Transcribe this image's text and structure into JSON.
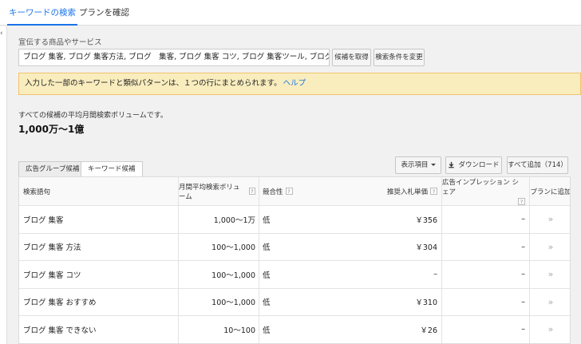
{
  "topnav": {
    "tabs": [
      "キーワードの検索",
      "プランを確認"
    ]
  },
  "leftbar": {
    "collapse_icon": "‹"
  },
  "search": {
    "label": "宣伝する商品やサービス",
    "value": "ブログ 集客, ブログ 集客方法, ブログ　集客, ブログ 集客 コツ, ブログ 集客ツール, ブログ 集客 おすすめ",
    "get_button": "候補を取得",
    "change_button": "検索条件を変更"
  },
  "notice": {
    "text": "入力した一部のキーワードと類似パターンは、１つの行にまとめられます。",
    "link": "ヘルプ"
  },
  "avg": {
    "label": "すべての候補の平均月間検索ボリュームです。",
    "value": "1,000万～1億"
  },
  "subtabs": [
    "広告グループ候補",
    "キーワード候補"
  ],
  "toolbar": {
    "columns": "表示項目",
    "download": "ダウンロード",
    "add_all": "すべて追加（714）"
  },
  "table": {
    "headers": {
      "keyword": "検索語句",
      "volume": "月間平均検索ボリューム",
      "competition": "競合性",
      "bid": "推奨入札単価",
      "share": "広告インプレッション シェア",
      "add": "プランに追加"
    },
    "rows": [
      {
        "keyword": "ブログ 集客",
        "volume": "1,000～1万",
        "competition": "低",
        "bid": "￥356",
        "share": "–"
      },
      {
        "keyword": "ブログ 集客 方法",
        "volume": "100～1,000",
        "competition": "低",
        "bid": "￥304",
        "share": "–"
      },
      {
        "keyword": "ブログ 集客 コツ",
        "volume": "100～1,000",
        "competition": "低",
        "bid": "–",
        "share": "–"
      },
      {
        "keyword": "ブログ 集客 おすすめ",
        "volume": "100～1,000",
        "competition": "低",
        "bid": "￥310",
        "share": "–"
      },
      {
        "keyword": "ブログ 集客 できない",
        "volume": "10～100",
        "competition": "低",
        "bid": "￥26",
        "share": "–"
      }
    ]
  },
  "colors": {
    "accent": "#1a73e8",
    "notice_bg": "#f9edbe"
  }
}
